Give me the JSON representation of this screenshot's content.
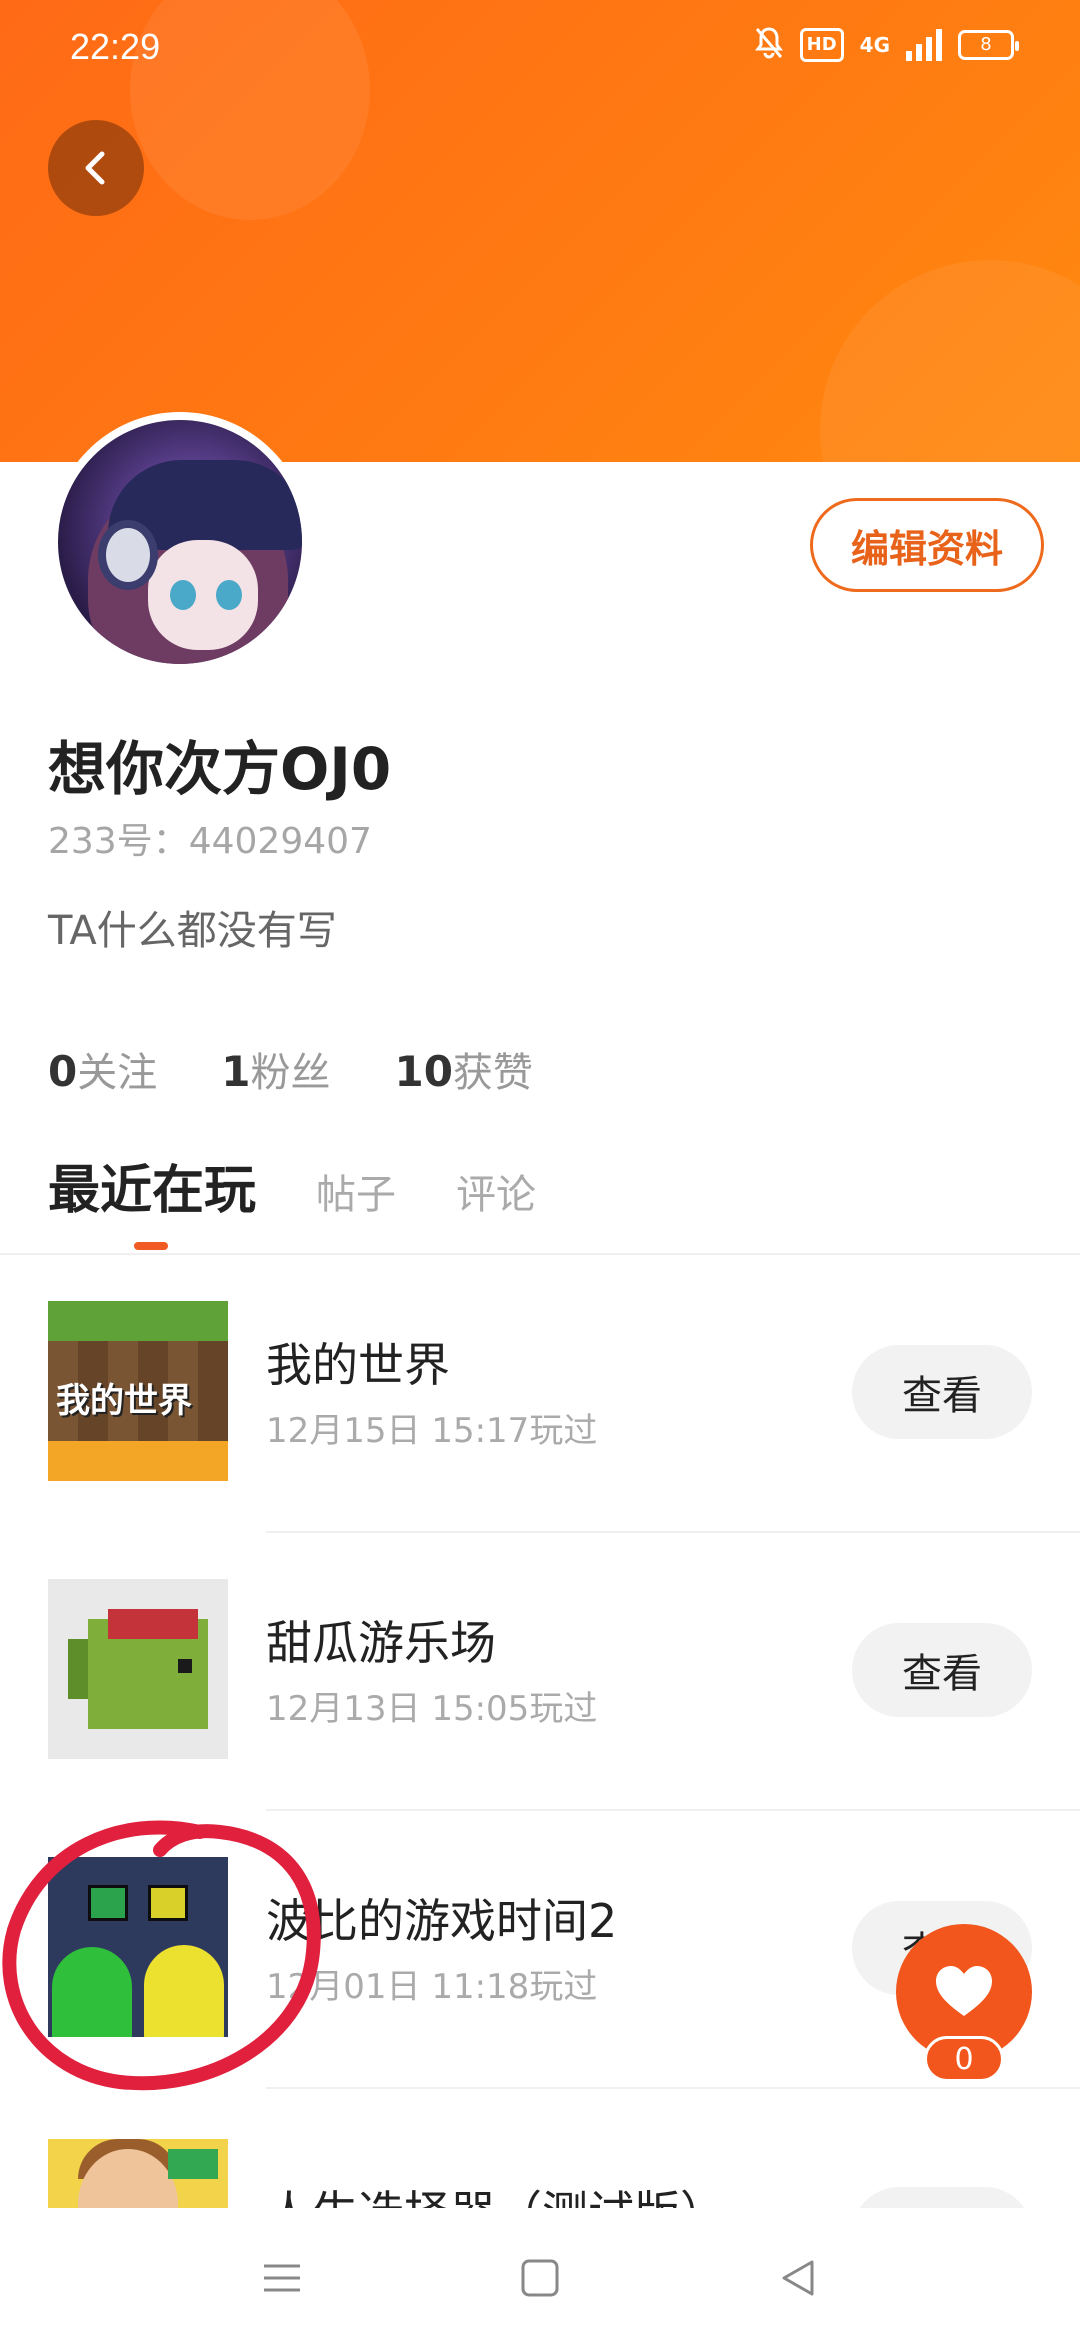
{
  "status_bar": {
    "time": "22:29",
    "hd": "HD",
    "network": "4G",
    "battery": "8"
  },
  "profile": {
    "nickname": "想你次方OJ0",
    "uid": "233号：44029407",
    "bio": "TA什么都没有写",
    "edit_button": "编辑资料"
  },
  "stats": [
    {
      "num": "0",
      "label": "关注"
    },
    {
      "num": "1",
      "label": "粉丝"
    },
    {
      "num": "10",
      "label": "获赞"
    }
  ],
  "tabs": [
    {
      "label": "最近在玩",
      "active": true
    },
    {
      "label": "帖子",
      "active": false
    },
    {
      "label": "评论",
      "active": false
    }
  ],
  "games": [
    {
      "name": "我的世界",
      "played": "12月15日 15:17玩过",
      "button": "查看",
      "thumb_text": "我的世界"
    },
    {
      "name": "甜瓜游乐场",
      "played": "12月13日 15:05玩过",
      "button": "查看"
    },
    {
      "name": "波比的游戏时间2",
      "played": "12月01日 11:18玩过",
      "button": "查看"
    },
    {
      "name": "人生选择器（测试版）",
      "played": "",
      "button": ""
    }
  ],
  "like": {
    "count": "0"
  },
  "colors": {
    "accent": "#f2561c",
    "banner": "#ff7a12",
    "annotation": "#e0203c"
  }
}
